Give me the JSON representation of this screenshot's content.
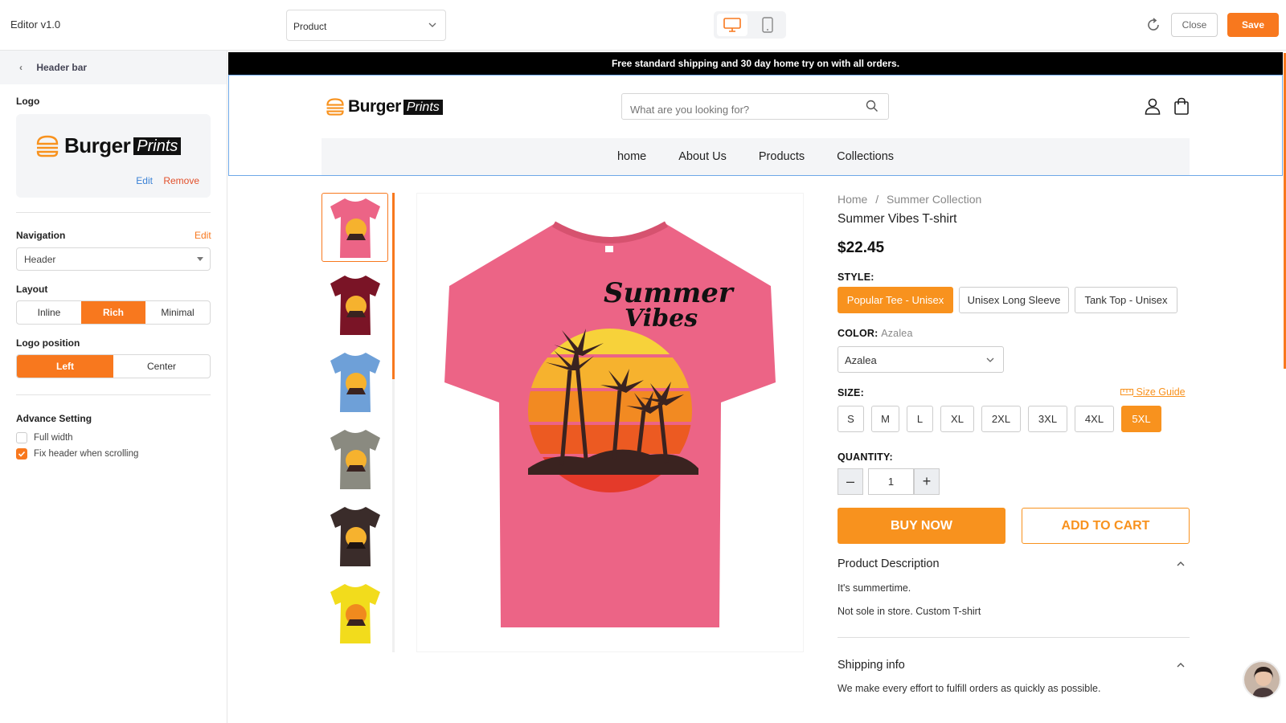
{
  "topbar": {
    "app_title": "Editor v1.0",
    "page_select": "Product",
    "close_label": "Close",
    "save_label": "Save"
  },
  "left_panel": {
    "header": "Header bar",
    "logo_label": "Logo",
    "logo_word": "Burger",
    "logo_prints": "Prints",
    "logo_edit": "Edit",
    "logo_remove": "Remove",
    "navigation_label": "Navigation",
    "navigation_edit": "Edit",
    "navigation_value": "Header",
    "layout_label": "Layout",
    "layout_options": [
      "Inline",
      "Rich",
      "Minimal"
    ],
    "layout_selected": "Rich",
    "logo_position_label": "Logo position",
    "logo_position_options": [
      "Left",
      "Center"
    ],
    "logo_position_selected": "Left",
    "advance_label": "Advance Setting",
    "full_width_label": "Full width",
    "full_width_checked": false,
    "fix_header_label": "Fix header when scrolling",
    "fix_header_checked": true
  },
  "store": {
    "announcement": "Free standard shipping and 30 day home try on with all orders.",
    "brand_word": "Burger",
    "brand_prints": "Prints",
    "search_placeholder": "What are you looking for?",
    "nav": [
      "home",
      "About Us",
      "Products",
      "Collections"
    ],
    "thumb_colors": [
      "#ec6486",
      "#7a1426",
      "#6ea0d8",
      "#8a8a80",
      "#3a2c2a",
      "#f2dc1c"
    ],
    "accent_color": "#f8921e",
    "shirt_color": "#ec6486"
  },
  "product": {
    "breadcrumb_home": "Home",
    "breadcrumb_sep": "/",
    "breadcrumb_collection": "Summer Collection",
    "title": "Summer Vibes T-shirt",
    "price": "$22.45",
    "style_label": "STYLE:",
    "styles": [
      "Popular Tee - Unisex",
      "Unisex Long Sleeve",
      "Tank Top - Unisex"
    ],
    "style_selected": "Popular Tee - Unisex",
    "color_label": "COLOR:",
    "color_value": "Azalea",
    "size_label": "SIZE:",
    "size_guide": "Size Guide",
    "sizes": [
      "S",
      "M",
      "L",
      "XL",
      "2XL",
      "3XL",
      "4XL",
      "5XL"
    ],
    "size_selected": "5XL",
    "quantity_label": "QUANTITY:",
    "quantity": "1",
    "buy_now": "BUY NOW",
    "add_to_cart": "ADD TO CART",
    "desc_title": "Product Description",
    "desc_line1": "It's summertime.",
    "desc_line2": "Not sole in store. Custom T-shirt",
    "shipping_title": "Shipping info",
    "shipping_line1": "We make every effort to fulfill orders as quickly as possible."
  }
}
